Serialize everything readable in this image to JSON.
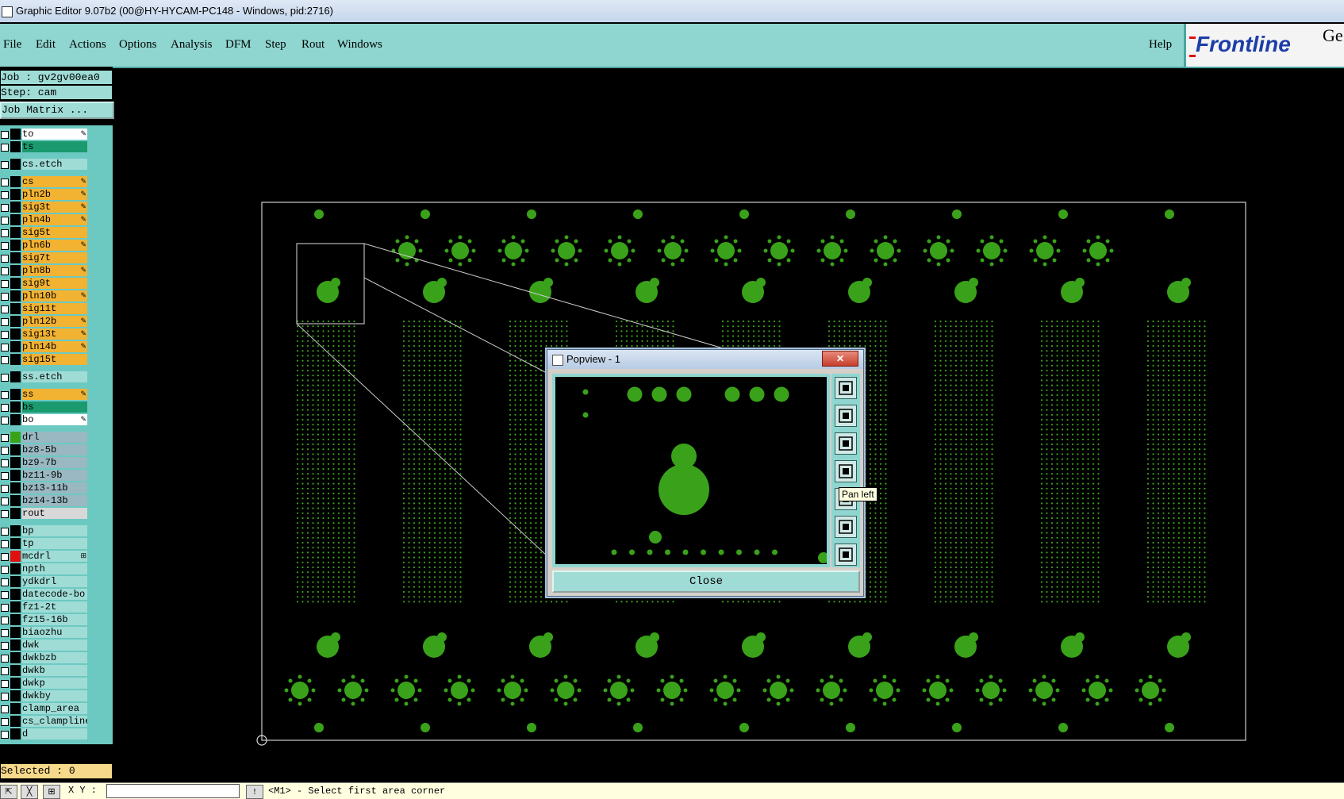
{
  "window": {
    "title": "Graphic Editor 9.07b2 (00@HY-HYCAM-PC148 - Windows, pid:2716)"
  },
  "menu": {
    "items": [
      "File",
      "Edit",
      "Actions",
      "Options",
      "Analysis",
      "DFM",
      "Step",
      "Rout",
      "Windows"
    ],
    "help": "Help"
  },
  "logo": {
    "brand": "Frontline",
    "extra": "Ge"
  },
  "job": {
    "job_line": "Job : gv2gv00ea0",
    "step_line": "Step: cam",
    "matrix_button": "Job Matrix ..."
  },
  "layers": [
    {
      "name": "to",
      "color": "#ffffff",
      "swatch": "#000000",
      "mark": "✎"
    },
    {
      "name": "ts",
      "color": "#1a9a6e",
      "swatch": "#000000",
      "mark": ""
    },
    {
      "name": "cs.etch",
      "color": "#9fdcd6",
      "swatch": "#000000",
      "mark": ""
    },
    {
      "name": "cs",
      "color": "#f2b232",
      "swatch": "#000000",
      "mark": "✎"
    },
    {
      "name": "pln2b",
      "color": "#f2b232",
      "swatch": "#000000",
      "mark": "✎"
    },
    {
      "name": "sig3t",
      "color": "#f2b232",
      "swatch": "#000000",
      "mark": "✎"
    },
    {
      "name": "pln4b",
      "color": "#f2b232",
      "swatch": "#000000",
      "mark": "✎"
    },
    {
      "name": "sig5t",
      "color": "#f2b232",
      "swatch": "#000000",
      "mark": ""
    },
    {
      "name": "pln6b",
      "color": "#f2b232",
      "swatch": "#000000",
      "mark": "✎"
    },
    {
      "name": "sig7t",
      "color": "#f2b232",
      "swatch": "#000000",
      "mark": ""
    },
    {
      "name": "pln8b",
      "color": "#f2b232",
      "swatch": "#000000",
      "mark": "✎"
    },
    {
      "name": "sig9t",
      "color": "#f2b232",
      "swatch": "#000000",
      "mark": ""
    },
    {
      "name": "pln10b",
      "color": "#f2b232",
      "swatch": "#000000",
      "mark": "✎"
    },
    {
      "name": "sig11t",
      "color": "#f2b232",
      "swatch": "#000000",
      "mark": ""
    },
    {
      "name": "pln12b",
      "color": "#f2b232",
      "swatch": "#000000",
      "mark": "✎"
    },
    {
      "name": "sig13t",
      "color": "#f2b232",
      "swatch": "#000000",
      "mark": "✎"
    },
    {
      "name": "pln14b",
      "color": "#f2b232",
      "swatch": "#000000",
      "mark": "✎"
    },
    {
      "name": "sig15t",
      "color": "#f2b232",
      "swatch": "#000000",
      "mark": ""
    },
    {
      "name": "ss.etch",
      "color": "#9fdcd6",
      "swatch": "#000000",
      "mark": ""
    },
    {
      "name": "ss",
      "color": "#f2b232",
      "swatch": "#000000",
      "mark": "✎"
    },
    {
      "name": "bs",
      "color": "#1a9a6e",
      "swatch": "#000000",
      "mark": ""
    },
    {
      "name": "bo",
      "color": "#ffffff",
      "swatch": "#000000",
      "mark": "✎"
    },
    {
      "name": "drl",
      "color": "#9ab8c2",
      "swatch": "#3aa21a",
      "mark": ""
    },
    {
      "name": "bz8-5b",
      "color": "#9ab8c2",
      "swatch": "#000000",
      "mark": ""
    },
    {
      "name": "bz9-7b",
      "color": "#9ab8c2",
      "swatch": "#000000",
      "mark": ""
    },
    {
      "name": "bz11-9b",
      "color": "#9ab8c2",
      "swatch": "#000000",
      "mark": ""
    },
    {
      "name": "bz13-11b",
      "color": "#9ab8c2",
      "swatch": "#000000",
      "mark": ""
    },
    {
      "name": "bz14-13b",
      "color": "#9ab8c2",
      "swatch": "#000000",
      "mark": ""
    },
    {
      "name": "rout",
      "color": "#d8d8d8",
      "swatch": "#000000",
      "mark": ""
    },
    {
      "name": "bp",
      "color": "#9fdcd6",
      "swatch": "#000000",
      "mark": ""
    },
    {
      "name": "tp",
      "color": "#9fdcd6",
      "swatch": "#000000",
      "mark": ""
    },
    {
      "name": "mcdrl",
      "color": "#9fdcd6",
      "swatch": "#e01010",
      "mark": "⊞"
    },
    {
      "name": "npth",
      "color": "#9fdcd6",
      "swatch": "#000000",
      "mark": ""
    },
    {
      "name": "ydkdrl",
      "color": "#9fdcd6",
      "swatch": "#000000",
      "mark": ""
    },
    {
      "name": "datecode-bo",
      "color": "#9fdcd6",
      "swatch": "#000000",
      "mark": ""
    },
    {
      "name": "fz1-2t",
      "color": "#9fdcd6",
      "swatch": "#000000",
      "mark": ""
    },
    {
      "name": "fz15-16b",
      "color": "#9fdcd6",
      "swatch": "#000000",
      "mark": ""
    },
    {
      "name": "biaozhu",
      "color": "#9fdcd6",
      "swatch": "#000000",
      "mark": ""
    },
    {
      "name": "dwk",
      "color": "#9fdcd6",
      "swatch": "#000000",
      "mark": ""
    },
    {
      "name": "dwkbzb",
      "color": "#9fdcd6",
      "swatch": "#000000",
      "mark": ""
    },
    {
      "name": "dwkb",
      "color": "#9fdcd6",
      "swatch": "#000000",
      "mark": ""
    },
    {
      "name": "dwkp",
      "color": "#9fdcd6",
      "swatch": "#000000",
      "mark": ""
    },
    {
      "name": "dwkby",
      "color": "#9fdcd6",
      "swatch": "#000000",
      "mark": ""
    },
    {
      "name": "clamp_area",
      "color": "#9fdcd6",
      "swatch": "#000000",
      "mark": ""
    },
    {
      "name": "cs_clampline",
      "color": "#9fdcd6",
      "swatch": "#000000",
      "mark": ""
    },
    {
      "name": "d",
      "color": "#9fdcd6",
      "swatch": "#000000",
      "mark": ""
    }
  ],
  "status": {
    "selected": "Selected : 0",
    "xy_label": "X Y :",
    "xy_value": "",
    "hint": "<M1> - Select first area corner"
  },
  "popview": {
    "title": "Popview - 1",
    "close_x": "✕",
    "close_button": "Close",
    "tooltip": "Pan left",
    "tools": [
      "zoom-window-icon",
      "pan-up-icon",
      "pan-down-icon",
      "pan-left-icon",
      "pan-right-icon",
      "zoom-fit-icon",
      "zoom-home-icon"
    ]
  },
  "colors": {
    "copper": "#3aa21a",
    "background": "#000000",
    "menubar": "#8fd6d0"
  }
}
